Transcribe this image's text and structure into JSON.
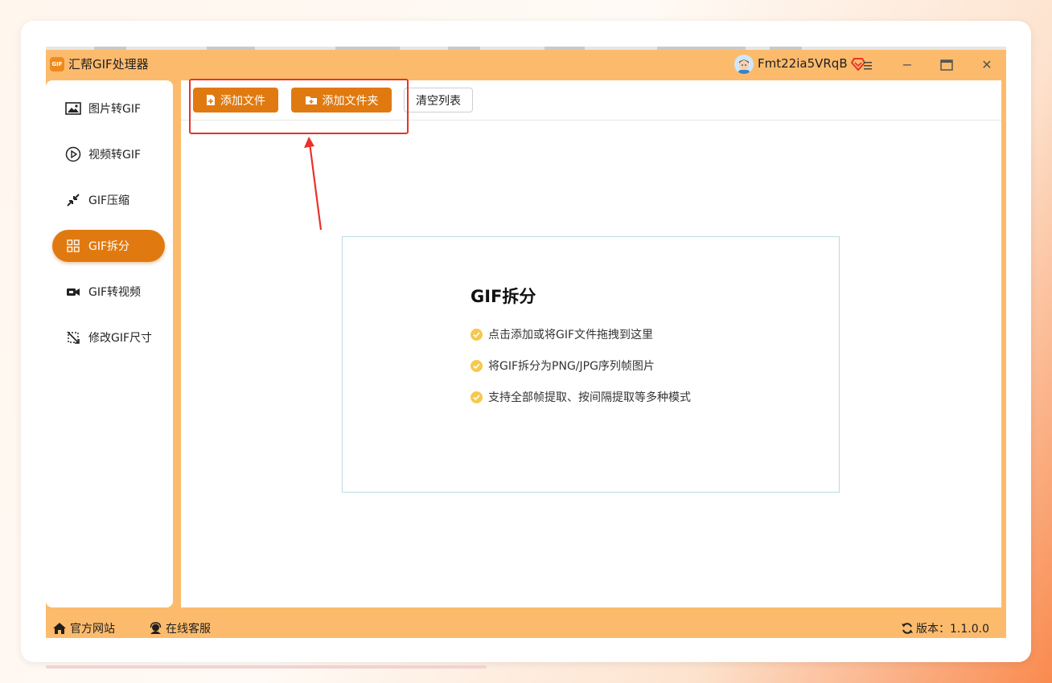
{
  "app": {
    "title": "汇帮GIF处理器",
    "logo_text": "GIF",
    "username": "Fmt22ia5VRqB",
    "accent": "#e07a10",
    "frame_color": "#fcbb6c"
  },
  "window_controls": {
    "menu": "menu-icon",
    "minimize": "−",
    "maximize": "▭",
    "close": "✕"
  },
  "sidebar": {
    "items": [
      {
        "label": "图片转GIF",
        "icon": "image-icon"
      },
      {
        "label": "视频转GIF",
        "icon": "play-circle-icon"
      },
      {
        "label": "GIF压缩",
        "icon": "compress-icon"
      },
      {
        "label": "GIF拆分",
        "icon": "grid-split-icon",
        "active": true
      },
      {
        "label": "GIF转视频",
        "icon": "video-camera-icon"
      },
      {
        "label": "修改GIF尺寸",
        "icon": "resize-icon"
      }
    ]
  },
  "toolbar": {
    "add_file": "添加文件",
    "add_folder": "添加文件夹",
    "clear_list": "清空列表"
  },
  "dropzone": {
    "title": "GIF拆分",
    "tips": [
      "点击添加或将GIF文件拖拽到这里",
      "将GIF拆分为PNG/JPG序列帧图片",
      "支持全部帧提取、按间隔提取等多种模式"
    ]
  },
  "statusbar": {
    "website": "官方网站",
    "support": "在线客服",
    "version": "版本：1.1.0.0"
  }
}
